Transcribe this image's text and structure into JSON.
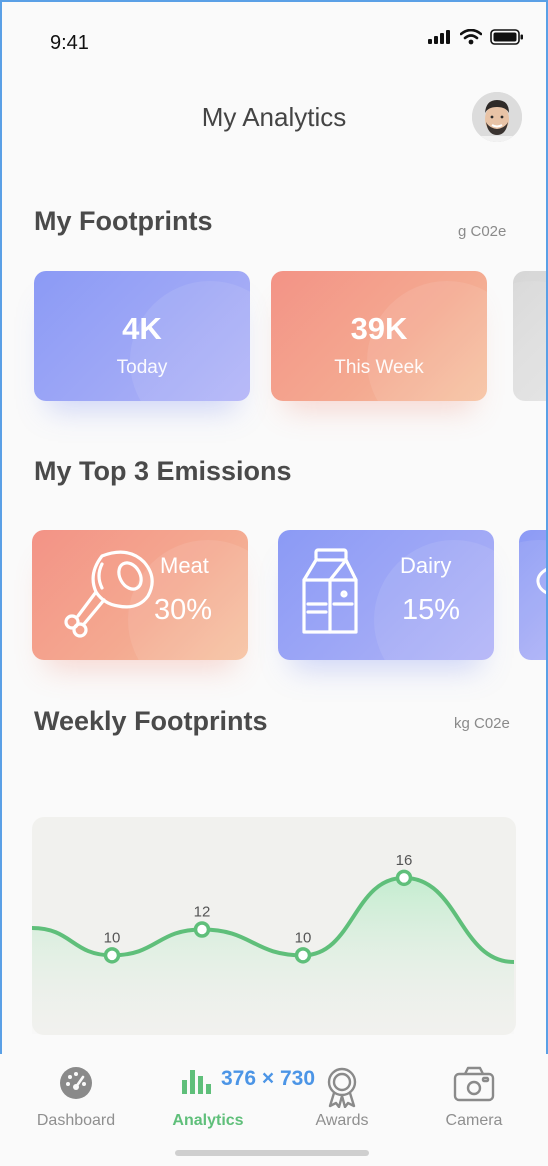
{
  "status_bar": {
    "time": "9:41"
  },
  "header": {
    "title": "My Analytics"
  },
  "footprints": {
    "title": "My Footprints",
    "unit": "g C02e",
    "cards": [
      {
        "value": "4K",
        "label": "Today",
        "color": "#9aa4f6"
      },
      {
        "value": "39K",
        "label": "This Week",
        "color": "#f4a08e"
      }
    ]
  },
  "emissions": {
    "title": "My Top 3 Emissions",
    "items": [
      {
        "name": "Meat",
        "percent": "30%",
        "icon": "meat-drumstick-icon",
        "color": "#f4a08e"
      },
      {
        "name": "Dairy",
        "percent": "15%",
        "icon": "milk-carton-icon",
        "color": "#9aa4f6"
      }
    ]
  },
  "weekly": {
    "title": "Weekly Footprints",
    "unit": "kg C02e"
  },
  "chart_data": {
    "type": "area",
    "x": [
      1,
      2,
      3,
      4
    ],
    "values": [
      10,
      12,
      10,
      16
    ],
    "data_labels": [
      "10",
      "12",
      "10",
      "16"
    ],
    "color": "#5fbf7a",
    "grid": false
  },
  "tabbar": {
    "tabs": [
      {
        "label": "Dashboard",
        "icon": "gauge-icon",
        "active": false
      },
      {
        "label": "Analytics",
        "icon": "bar-chart-icon",
        "active": true
      },
      {
        "label": "Awards",
        "icon": "award-medal-icon",
        "active": false
      },
      {
        "label": "Camera",
        "icon": "camera-icon",
        "active": false
      }
    ],
    "active_color": "#5fbf7a"
  },
  "overlay": {
    "dimension_text": "376 × 730"
  }
}
